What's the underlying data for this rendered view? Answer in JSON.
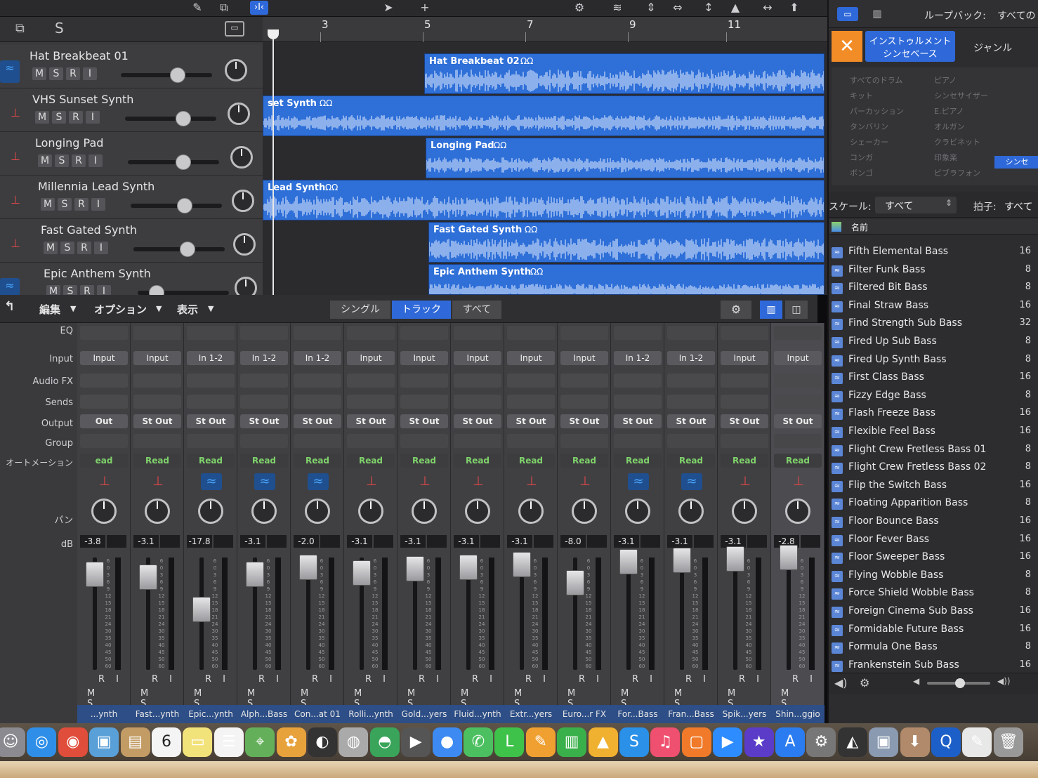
{
  "toolbar": {
    "catch_label": "›I‹"
  },
  "library_header": {
    "loop_label": "ループバック:",
    "loop_value": "すべての",
    "tab_instrument_line1": "インストゥルメント",
    "tab_instrument_line2": "シンセベース",
    "tab_genre": "ジャンル",
    "scale_label": "スケール:",
    "scale_value": "すべて",
    "beat_label": "拍子:",
    "beat_value": "すべて",
    "name_header": "名前"
  },
  "categories": {
    "col1": [
      "すべてのドラム",
      "キット",
      "パーカッション",
      "タンバリン",
      "シェーカー",
      "コンガ",
      "ボンゴ"
    ],
    "col2": [
      "ピアノ",
      "シンセサイザー",
      "E.ピアノ",
      "オルガン",
      "クラビネット",
      "印象楽",
      "ビブラフォン"
    ],
    "col3_selected": "シンセ"
  },
  "ruler": {
    "bars": [
      "3",
      "5",
      "7",
      "9",
      "11"
    ]
  },
  "tracks": [
    {
      "name": "Hat Breakbeat 01",
      "buttons": [
        "M",
        "S",
        "R",
        "I"
      ],
      "icon": "waveform-icon"
    },
    {
      "name": "VHS Sunset Synth",
      "buttons": [
        "M",
        "S",
        "R",
        "I"
      ],
      "icon": "keyboard-icon"
    },
    {
      "name": "Longing Pad",
      "buttons": [
        "M",
        "S",
        "R",
        "I"
      ],
      "icon": "keyboard-icon"
    },
    {
      "name": "Millennia Lead Synth",
      "buttons": [
        "M",
        "S",
        "R",
        "I"
      ],
      "icon": "keyboard-icon"
    },
    {
      "name": "Fast Gated Synth",
      "buttons": [
        "M",
        "S",
        "R",
        "I"
      ],
      "icon": "keyboard-icon"
    },
    {
      "name": "Epic Anthem Synth",
      "buttons": [
        "M",
        "S",
        "R",
        "I"
      ],
      "icon": "waveform-icon"
    }
  ],
  "regions": [
    {
      "label": "Hat Breakbeat 02"
    },
    {
      "label": "set Synth"
    },
    {
      "label": "Longing Pad"
    },
    {
      "label": "Lead Synth"
    },
    {
      "label": "Fast Gated Synth"
    },
    {
      "label": "Epic Anthem Synth"
    }
  ],
  "mixer_menu": {
    "edit": "編集",
    "options": "オプション",
    "view": "表示",
    "tab_single": "シングル",
    "tab_track": "トラック",
    "tab_all": "すべて"
  },
  "mixer_rows": {
    "eq": "EQ",
    "input": "Input",
    "audio_fx": "Audio FX",
    "sends": "Sends",
    "output": "Output",
    "group": "Group",
    "automation": "オートメーション",
    "pan": "パン",
    "db": "dB"
  },
  "strips": [
    {
      "input": "Input",
      "output": "Out",
      "auto": "ead",
      "db": "-3.8",
      "name": "...ynth",
      "icon": "keyboard-icon"
    },
    {
      "input": "Input",
      "output": "St Out",
      "auto": "Read",
      "db": "-3.1",
      "name": "Fast...ynth",
      "icon": "keyboard-icon"
    },
    {
      "input": "In 1-2",
      "output": "St Out",
      "auto": "Read",
      "db": "-17.8",
      "name": "Epic...ynth",
      "icon": "waveform-icon"
    },
    {
      "input": "In 1-2",
      "output": "St Out",
      "auto": "Read",
      "db": "-3.1",
      "name": "Alph...Bass",
      "icon": "waveform-icon"
    },
    {
      "input": "In 1-2",
      "output": "St Out",
      "auto": "Read",
      "db": "-2.0",
      "name": "Con...at 01",
      "icon": "waveform-icon"
    },
    {
      "input": "Input",
      "output": "St Out",
      "auto": "Read",
      "db": "-3.1",
      "name": "Rolli...ynth",
      "icon": "keyboard-icon"
    },
    {
      "input": "Input",
      "output": "St Out",
      "auto": "Read",
      "db": "-3.1",
      "name": "Gold...yers",
      "icon": "keyboard-icon"
    },
    {
      "input": "Input",
      "output": "St Out",
      "auto": "Read",
      "db": "-3.1",
      "name": "Fluid...ynth",
      "icon": "keyboard-icon"
    },
    {
      "input": "Input",
      "output": "St Out",
      "auto": "Read",
      "db": "-3.1",
      "name": "Extr...yers",
      "icon": "keyboard-icon"
    },
    {
      "input": "Input",
      "output": "St Out",
      "auto": "Read",
      "db": "-8.0",
      "name": "Euro...r FX",
      "icon": "keyboard-icon"
    },
    {
      "input": "In 1-2",
      "output": "St Out",
      "auto": "Read",
      "db": "-3.1",
      "name": "For...Bass",
      "icon": "waveform-icon"
    },
    {
      "input": "In 1-2",
      "output": "St Out",
      "auto": "Read",
      "db": "-3.1",
      "name": "Fran...Bass",
      "icon": "waveform-icon"
    },
    {
      "input": "Input",
      "output": "St Out",
      "auto": "Read",
      "db": "-3.1",
      "name": "Spik...yers",
      "icon": "keyboard-icon"
    },
    {
      "input": "Input",
      "output": "St Out",
      "auto": "Read",
      "db": "-2.8",
      "name": "Shin...ggio",
      "icon": "keyboard-icon"
    }
  ],
  "fader_scale": [
    "6",
    "0",
    "3",
    "6",
    "9",
    "12",
    "15",
    "18",
    "21",
    "24",
    "30",
    "35",
    "40",
    "45",
    "50",
    "60"
  ],
  "strip_buttons": {
    "ri": "R I",
    "ms": "M S"
  },
  "presets": [
    {
      "name": "Fifth Elemental Bass",
      "count": "16"
    },
    {
      "name": "Filter Funk Bass",
      "count": "8"
    },
    {
      "name": "Filtered Bit Bass",
      "count": "8"
    },
    {
      "name": "Final Straw Bass",
      "count": "16"
    },
    {
      "name": "Find Strength Sub Bass",
      "count": "32"
    },
    {
      "name": "Fired Up Sub Bass",
      "count": "8"
    },
    {
      "name": "Fired Up Synth Bass",
      "count": "8"
    },
    {
      "name": "First Class Bass",
      "count": "16"
    },
    {
      "name": "Fizzy Edge Bass",
      "count": "8"
    },
    {
      "name": "Flash Freeze Bass",
      "count": "16"
    },
    {
      "name": "Flexible Feel Bass",
      "count": "16"
    },
    {
      "name": "Flight Crew Fretless Bass 01",
      "count": "8"
    },
    {
      "name": "Flight Crew Fretless Bass 02",
      "count": "8"
    },
    {
      "name": "Flip the Switch Bass",
      "count": "16"
    },
    {
      "name": "Floating Apparition Bass",
      "count": "8"
    },
    {
      "name": "Floor Bounce Bass",
      "count": "16"
    },
    {
      "name": "Floor Fever Bass",
      "count": "16"
    },
    {
      "name": "Floor Sweeper Bass",
      "count": "16"
    },
    {
      "name": "Flying Wobble Bass",
      "count": "8"
    },
    {
      "name": "Force Shield Wobble Bass",
      "count": "8"
    },
    {
      "name": "Foreign Cinema Sub Bass",
      "count": "16"
    },
    {
      "name": "Formidable Future Bass",
      "count": "16"
    },
    {
      "name": "Formula One Bass",
      "count": "8"
    },
    {
      "name": "Frankenstein Sub Bass",
      "count": "16"
    }
  ],
  "dock": {
    "calendar_day": "6",
    "apps": [
      "finder-icon",
      "safari-icon",
      "chrome-icon",
      "preview-icon",
      "notes-icon",
      "calendar-icon",
      "stickies-icon",
      "reminders-icon",
      "maps-icon",
      "photos-icon",
      "lumaflex-icon",
      "cd-icon",
      "logic-icon",
      "final-cut-icon",
      "messages-icon",
      "facetime-icon",
      "line-icon",
      "pages-icon",
      "numbers-icon",
      "keynote-icon",
      "skype-icon",
      "music-icon",
      "books-icon",
      "zoom-icon",
      "imovie-icon",
      "app-store-icon",
      "system-prefs-icon",
      "logic-pro-icon",
      "image-capture-icon",
      "compressor-icon",
      "quicktime-icon",
      "text-edit-icon",
      "trash-icon"
    ]
  },
  "colors": {
    "region_blue": "#2e6fd8",
    "accent_blue": "#2f69d9",
    "read_green": "#7fd36a",
    "instrument_red": "#e04848"
  }
}
